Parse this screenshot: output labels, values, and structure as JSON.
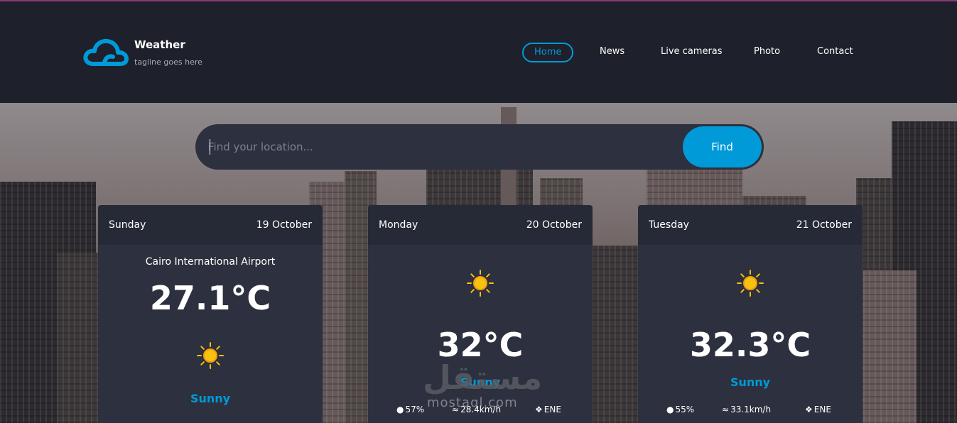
{
  "brand": {
    "name": "Weather",
    "tagline": "tagline goes here"
  },
  "nav": [
    {
      "label": "Home",
      "active": true
    },
    {
      "label": "News",
      "active": false
    },
    {
      "label": "Live cameras",
      "active": false
    },
    {
      "label": "Photo",
      "active": false
    },
    {
      "label": "Contact",
      "active": false
    }
  ],
  "search": {
    "placeholder": "Find your location...",
    "value": "",
    "button": "Find"
  },
  "cards": [
    {
      "day": "Sunday",
      "date": "19 October",
      "location": "Cairo International Airport",
      "temperature": "27.1°C",
      "icon": "sun-icon",
      "condition": "Sunny"
    },
    {
      "day": "Monday",
      "date": "20 October",
      "temperature": "32°C",
      "icon": "sun-icon",
      "condition": "Sunny",
      "humidity": "57%",
      "wind_speed": "28.4km/h",
      "wind_direction": "ENE"
    },
    {
      "day": "Tuesday",
      "date": "21 October",
      "temperature": "32.3°C",
      "icon": "sun-icon",
      "condition": "Sunny",
      "humidity": "55%",
      "wind_speed": "33.1km/h",
      "wind_direction": "ENE"
    }
  ],
  "watermark": {
    "arabic": "مستقل",
    "latin": "mostaql.com"
  },
  "colors": {
    "accent": "#009ad8",
    "header_bg": "#1e202b",
    "card_bg": "#2d303e",
    "sun": "#f7c20f"
  }
}
